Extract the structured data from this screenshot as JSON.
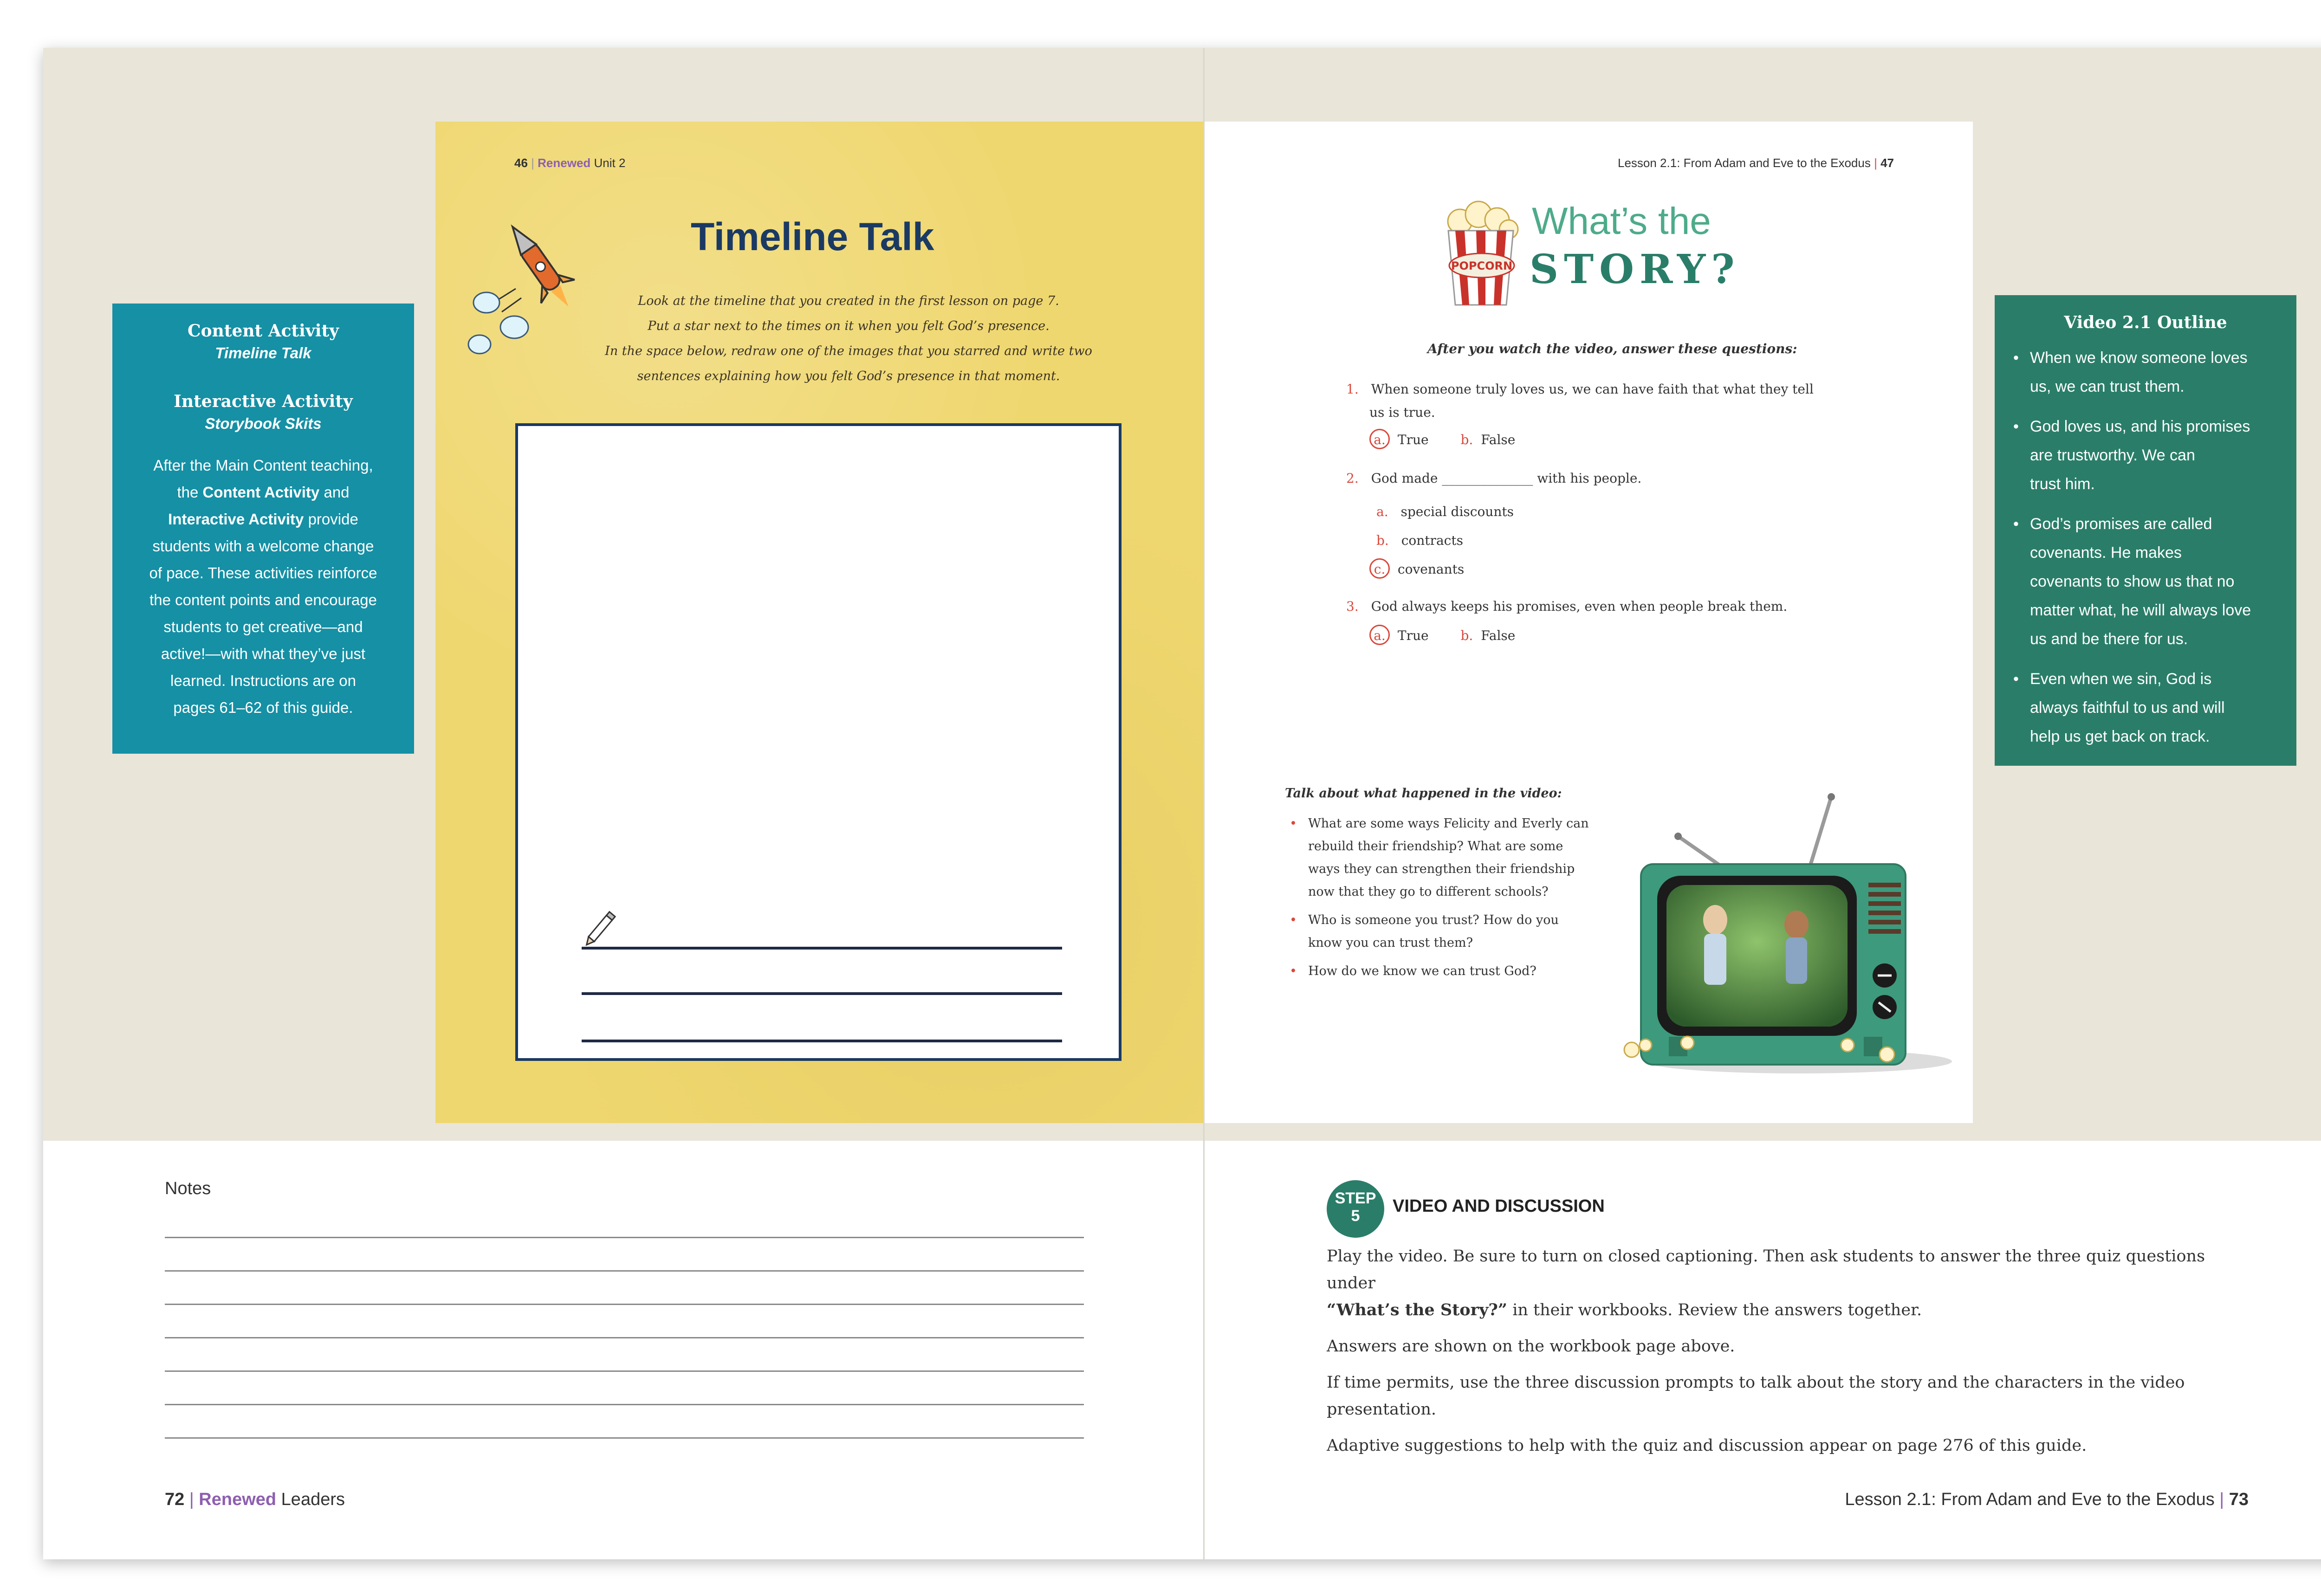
{
  "workbook_left": {
    "page_number": "46",
    "brand": "Renewed",
    "unit": "Unit 2",
    "title": "Timeline Talk",
    "instructions": [
      "Look at the timeline that you created in the first lesson on page 7.",
      "Put a star next to the times on it when you felt God’s presence.",
      "In the space below, redraw one of the images that you starred and write two",
      "sentences explaining how you felt God’s presence in that moment."
    ]
  },
  "workbook_right": {
    "running_head": "Lesson 2.1: From Adam and Eve to the Exodus",
    "page_number": "47",
    "popcorn_label": "POPCORN",
    "title_line1": "What’s the",
    "title_line2": "STORY?",
    "quiz_intro": "After you watch the video, answer these questions:",
    "questions": [
      {
        "num": "1.",
        "text_line1": "When someone truly loves us, we can have faith that what they tell",
        "text_line2": "us is true.",
        "options": [
          {
            "letter": "a.",
            "label": "True"
          },
          {
            "letter": "b.",
            "label": "False"
          }
        ]
      },
      {
        "num": "2.",
        "text_before": "God made",
        "blank": "______________",
        "text_after": "with his people.",
        "options": [
          {
            "letter": "a.",
            "label": "special discounts"
          },
          {
            "letter": "b.",
            "label": "contracts"
          },
          {
            "letter": "c.",
            "label": "covenants"
          }
        ]
      },
      {
        "num": "3.",
        "text_line1": "God always keeps his promises, even when people break them.",
        "options": [
          {
            "letter": "a.",
            "label": "True"
          },
          {
            "letter": "b.",
            "label": "False"
          }
        ]
      }
    ],
    "talk_heading": "Talk about what happened in the video:",
    "talk_items": [
      [
        "What are some ways Felicity and Everly can",
        "rebuild their friendship? What are some",
        "ways they can strengthen their friendship",
        "now that they go to different schools?"
      ],
      [
        "Who is someone you trust? How do you",
        "know you can trust them?"
      ],
      [
        "How do we know we can trust God?"
      ]
    ]
  },
  "content_box": {
    "heading1": "Content Activity",
    "sub1": "Timeline Talk",
    "heading2": "Interactive Activity",
    "sub2": "Storybook Skits",
    "body_lines": [
      "After the Main Content teaching,",
      [
        "the ",
        "Content Activity",
        " and"
      ],
      [
        "",
        "Interactive Activity",
        " provide"
      ],
      "students with a welcome change",
      "of pace. These activities reinforce",
      "the content points and encourage",
      "students to get creative—and",
      "active!—with what they’ve just",
      "learned. Instructions are on",
      "pages 61–62 of this guide."
    ]
  },
  "video_box": {
    "heading": "Video 2.1 Outline",
    "items": [
      [
        "When we know someone loves",
        "us, we can trust them."
      ],
      [
        "God loves us, and his promises",
        "are trustworthy. We can",
        "trust him."
      ],
      [
        "God’s promises are called",
        "covenants. He makes",
        "covenants to show us that no",
        "matter what, he will always love",
        "us and be there for us."
      ],
      [
        "Even when we sin, God is",
        "always faithful to us and will",
        "help us get back on track."
      ]
    ]
  },
  "notes": {
    "label": "Notes"
  },
  "step": {
    "badge_word": "STEP",
    "badge_num": "5",
    "title": "VIDEO AND DISCUSSION",
    "p1_line1": "Play the video. Be sure to turn on closed captioning. Then ask students to answer the three quiz questions under",
    "p1_bold": "“What’s the Story?”",
    "p1_rest": " in their workbooks. Review the answers together.",
    "p2": "Answers are shown on the workbook page above.",
    "p3": "If time permits, use the three discussion prompts to talk about the story and the characters in the video presentation.",
    "p4": "Adaptive suggestions to help with the quiz and discussion appear on page 276 of this guide."
  },
  "footer_left": {
    "page": "72",
    "brand": "Renewed",
    "label": "Leaders"
  },
  "footer_right": {
    "label": "Lesson 2.1: From Adam and Eve to the Exodus",
    "page": "73"
  },
  "colors": {
    "teal_box": "#1590a5",
    "green_box": "#2a7e69",
    "workbook_yellow": "#efd76f",
    "answer_red": "#d9483b",
    "brand_purple": "#8d5fb0",
    "title_navy": "#1b3a63"
  },
  "icons": [
    "rocket-icon",
    "pencil-icon",
    "popcorn-icon",
    "tv-icon"
  ]
}
